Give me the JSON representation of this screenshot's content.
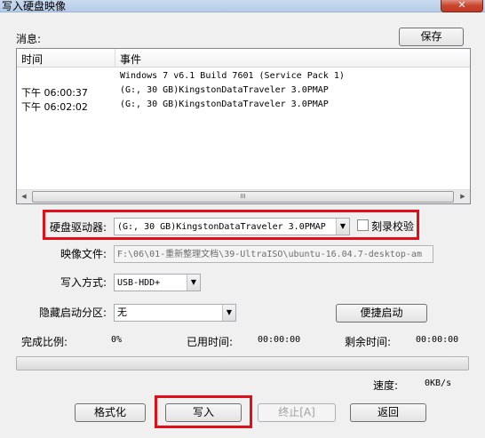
{
  "window": {
    "title": "写入硬盘映像",
    "close_glyph": "✕"
  },
  "messages": {
    "label": "消息:",
    "save_button": "保存",
    "columns": {
      "time": "时间",
      "event": "事件"
    },
    "rows": [
      {
        "time": "",
        "event": "Windows 7 v6.1 Build 7601 (Service Pack 1)"
      },
      {
        "time": "下午 06:00:37",
        "event": "(G:, 30 GB)KingstonDataTraveler 3.0PMAP"
      },
      {
        "time": "下午 06:02:02",
        "event": "(G:, 30 GB)KingstonDataTraveler 3.0PMAP"
      }
    ],
    "scroll_grip": "III"
  },
  "form": {
    "drive_label": "硬盘驱动器:",
    "drive_value": "(G:, 30 GB)KingstonDataTraveler 3.0PMAP",
    "verify_label": "刻录校验",
    "verify_checked": false,
    "image_label": "映像文件:",
    "image_value": "F:\\06\\01-重新整理文档\\39-UltraISO\\ubuntu-16.04.7-desktop-am",
    "write_mode_label": "写入方式:",
    "write_mode_value": "USB-HDD+",
    "hidden_partition_label": "隐藏启动分区:",
    "hidden_partition_value": "无",
    "quick_boot_button": "便捷启动"
  },
  "progress": {
    "complete_label": "完成比例:",
    "complete_value": "0%",
    "complete_fraction": 0,
    "elapsed_label": "已用时间:",
    "elapsed_value": "00:00:00",
    "remaining_label": "剩余时间:",
    "remaining_value": "00:00:00",
    "speed_label": "速度:",
    "speed_value": "0KB/s"
  },
  "buttons": {
    "format": "格式化",
    "write": "写入",
    "stop": "终止[A]",
    "back": "返回"
  },
  "colors": {
    "highlight": "#e0101a",
    "close_button": "#c8452f"
  }
}
